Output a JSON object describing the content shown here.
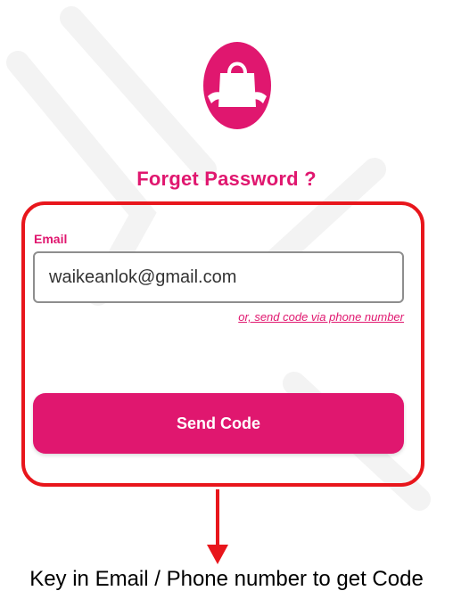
{
  "page": {
    "title": "Forget Password ?"
  },
  "form": {
    "email_label": "Email",
    "email_value": "waikeanlok@gmail.com",
    "alt_link": "or, send code via phone number",
    "send_button": "Send Code"
  },
  "annotation": {
    "caption": "Key in Email / Phone number to get Code"
  },
  "icons": {
    "logo": "shopping-bag-with-hands-icon",
    "arrow": "arrow-down-icon"
  },
  "colors": {
    "brand": "#e0176f",
    "highlight": "#e8161c"
  }
}
